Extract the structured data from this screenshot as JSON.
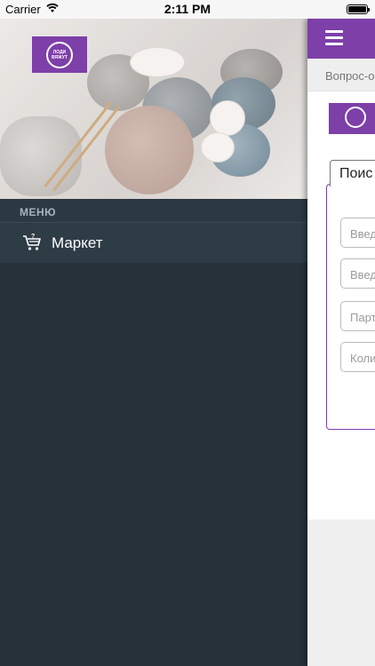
{
  "status_bar": {
    "carrier": "Carrier",
    "time": "2:11 PM"
  },
  "drawer": {
    "logo_text": "ЛОДИ\nВЯЖУТ",
    "section_title": "МЕНЮ",
    "items": [
      {
        "label": "Маркет",
        "icon": "shopping-cart-icon"
      }
    ]
  },
  "main": {
    "breadcrumb": "Вопрос-о",
    "tab_label": "Поис",
    "fields": [
      {
        "placeholder": "Введ"
      },
      {
        "placeholder": "Введ"
      },
      {
        "placeholder": "Парт"
      },
      {
        "placeholder": "Коли"
      }
    ]
  },
  "colors": {
    "accent": "#7d3fa8",
    "drawer_bg": "#26313a",
    "menu_item_bg": "#2e3c46",
    "menu_header_text": "#a8b4bd"
  }
}
